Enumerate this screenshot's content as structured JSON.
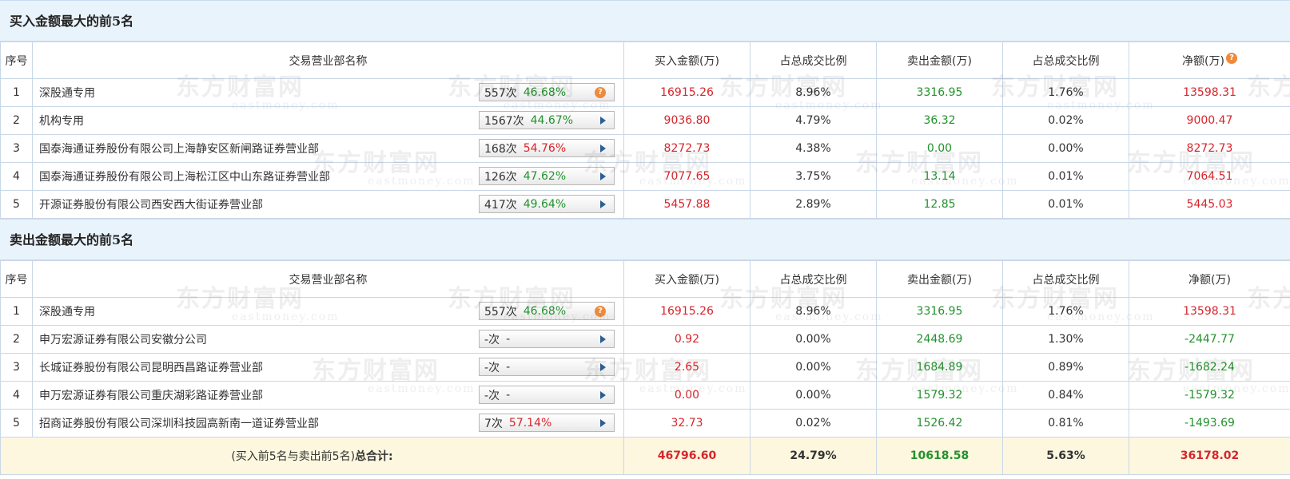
{
  "buy_section": {
    "title": "买入金额最大的前5名",
    "headers": [
      "序号",
      "交易营业部名称",
      "买入金额(万)",
      "占总成交比例",
      "卖出金额(万)",
      "占总成交比例",
      "净额(万)"
    ],
    "rows": [
      {
        "index": "1",
        "name": "深股通专用",
        "count": "557次",
        "pct": "46.68%",
        "pct_color": "green",
        "action": "help",
        "buy": "16915.26",
        "buy_ratio": "8.96%",
        "sell": "3316.95",
        "sell_ratio": "1.76%",
        "net": "13598.31"
      },
      {
        "index": "2",
        "name": "机构专用",
        "count": "1567次",
        "pct": "44.67%",
        "pct_color": "green",
        "action": "arrow",
        "buy": "9036.80",
        "buy_ratio": "4.79%",
        "sell": "36.32",
        "sell_ratio": "0.02%",
        "net": "9000.47"
      },
      {
        "index": "3",
        "name": "国泰海通证券股份有限公司上海静安区新闸路证券营业部",
        "count": "168次",
        "pct": "54.76%",
        "pct_color": "red",
        "action": "arrow",
        "buy": "8272.73",
        "buy_ratio": "4.38%",
        "sell": "0.00",
        "sell_ratio": "0.00%",
        "net": "8272.73"
      },
      {
        "index": "4",
        "name": "国泰海通证券股份有限公司上海松江区中山东路证券营业部",
        "count": "126次",
        "pct": "47.62%",
        "pct_color": "green",
        "action": "arrow",
        "buy": "7077.65",
        "buy_ratio": "3.75%",
        "sell": "13.14",
        "sell_ratio": "0.01%",
        "net": "7064.51"
      },
      {
        "index": "5",
        "name": "开源证券股份有限公司西安西大街证券营业部",
        "count": "417次",
        "pct": "49.64%",
        "pct_color": "green",
        "action": "arrow",
        "buy": "5457.88",
        "buy_ratio": "2.89%",
        "sell": "12.85",
        "sell_ratio": "0.01%",
        "net": "5445.03"
      }
    ]
  },
  "sell_section": {
    "title": "卖出金额最大的前5名",
    "headers": [
      "序号",
      "交易营业部名称",
      "买入金额(万)",
      "占总成交比例",
      "卖出金额(万)",
      "占总成交比例",
      "净额(万)"
    ],
    "rows": [
      {
        "index": "1",
        "name": "深股通专用",
        "count": "557次",
        "pct": "46.68%",
        "pct_color": "green",
        "action": "help",
        "buy": "16915.26",
        "buy_ratio": "8.96%",
        "sell": "3316.95",
        "sell_ratio": "1.76%",
        "net": "13598.31"
      },
      {
        "index": "2",
        "name": "申万宏源证券有限公司安徽分公司",
        "count": "-次",
        "pct": "-",
        "pct_color": "dark",
        "action": "arrow",
        "buy": "0.92",
        "buy_ratio": "0.00%",
        "sell": "2448.69",
        "sell_ratio": "1.30%",
        "net": "-2447.77"
      },
      {
        "index": "3",
        "name": "长城证券股份有限公司昆明西昌路证券营业部",
        "count": "-次",
        "pct": "-",
        "pct_color": "dark",
        "action": "arrow",
        "buy": "2.65",
        "buy_ratio": "0.00%",
        "sell": "1684.89",
        "sell_ratio": "0.89%",
        "net": "-1682.24"
      },
      {
        "index": "4",
        "name": "申万宏源证券有限公司重庆湖彩路证券营业部",
        "count": "-次",
        "pct": "-",
        "pct_color": "dark",
        "action": "arrow",
        "buy": "0.00",
        "buy_ratio": "0.00%",
        "sell": "1579.32",
        "sell_ratio": "0.84%",
        "net": "-1579.32"
      },
      {
        "index": "5",
        "name": "招商证券股份有限公司深圳科技园高新南一道证券营业部",
        "count": "7次",
        "pct": "57.14%",
        "pct_color": "red",
        "action": "arrow",
        "buy": "32.73",
        "buy_ratio": "0.02%",
        "sell": "1526.42",
        "sell_ratio": "0.81%",
        "net": "-1493.69"
      }
    ]
  },
  "total": {
    "label_prefix": "(买入前5名与卖出前5名)",
    "label_bold": "总合计:",
    "buy": "46796.60",
    "buy_ratio": "24.79%",
    "sell": "10618.58",
    "sell_ratio": "5.63%",
    "net": "36178.02"
  },
  "watermark": {
    "cn": "东方财富网",
    "en": "eastmoney.com"
  },
  "colors": {
    "red": "#d6262c",
    "green": "#22922c",
    "header_bg": "#e9f3fb",
    "total_bg": "#fdf7df",
    "border": "#c9d7e6",
    "help_icon": "#ef8a3a",
    "arrow_icon": "#2a5f92"
  },
  "icons": {
    "help": "question-icon",
    "arrow": "arrow-right-icon"
  }
}
